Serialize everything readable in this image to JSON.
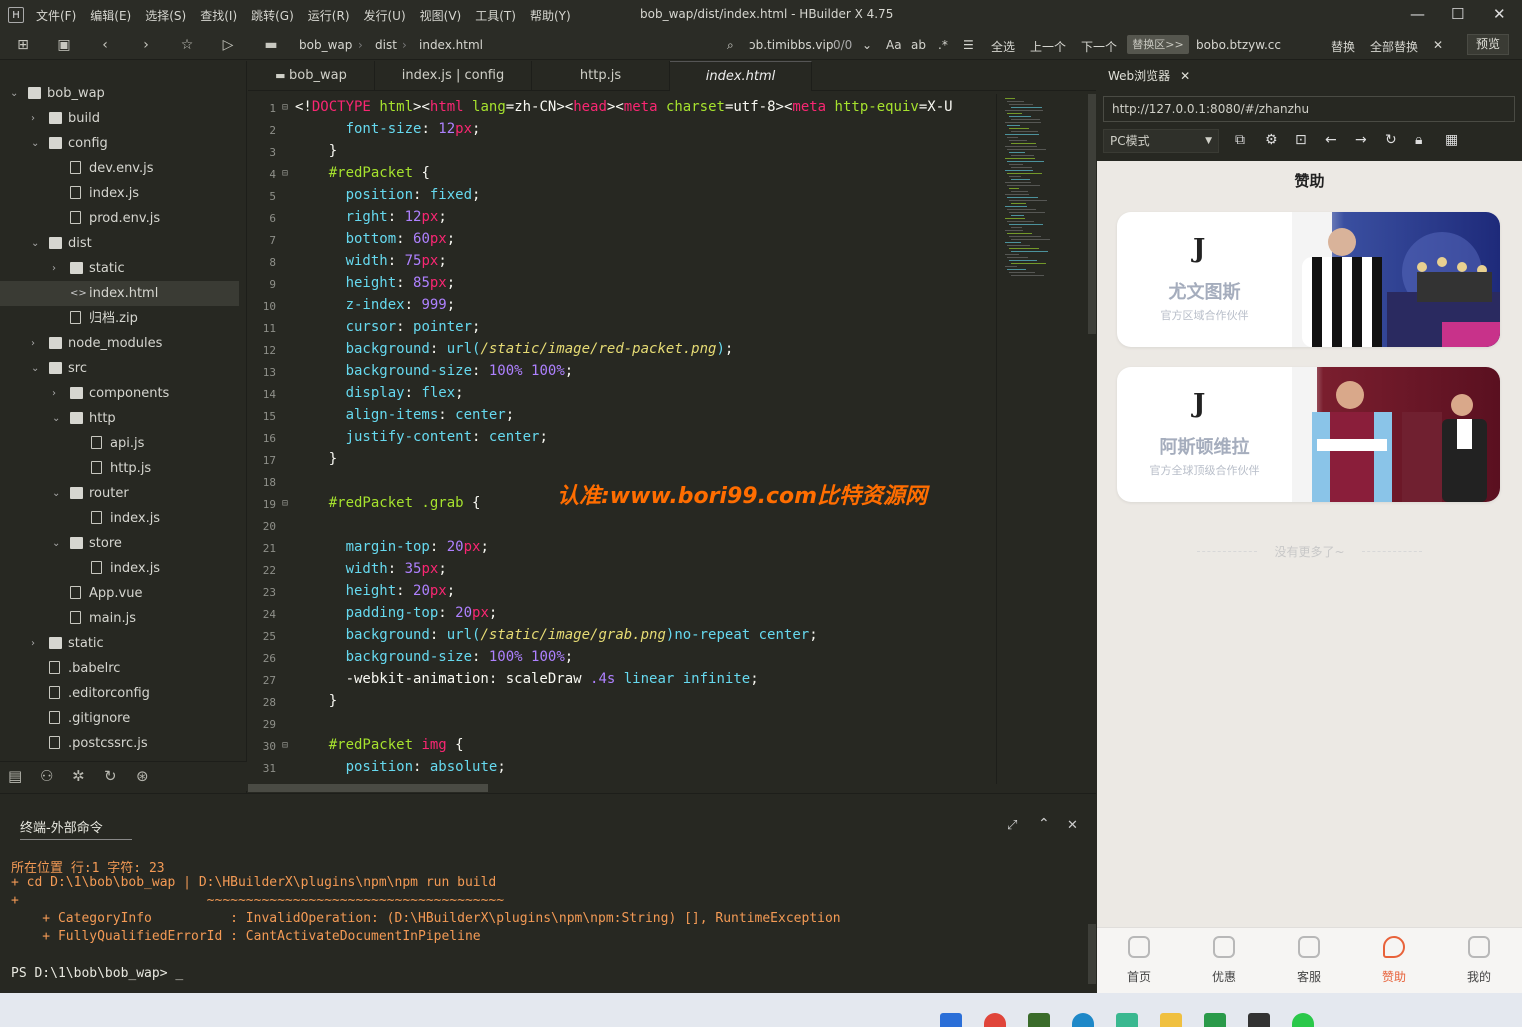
{
  "window": {
    "title": "bob_wap/dist/index.html - HBuilder X 4.75",
    "logo": "H",
    "menus": [
      "文件(F)",
      "编辑(E)",
      "选择(S)",
      "查找(I)",
      "跳转(G)",
      "运行(R)",
      "发行(U)",
      "视图(V)",
      "工具(T)",
      "帮助(Y)"
    ],
    "controls": {
      "minimize": "—",
      "maximize": "☐",
      "close": "✕"
    }
  },
  "toolbar": {
    "breadcrumb": [
      "bob_wap",
      "dist",
      "index.html"
    ],
    "search_value": "ɔb.timibbs.vip",
    "match_count": "0/0",
    "select_all": "全选",
    "prev": "上一个",
    "next": "下一个",
    "replace_area": "替换区>>",
    "replace_value": "bobo.btzyw.cc",
    "replace": "替换",
    "replace_all": "全部替换",
    "preview": "预览"
  },
  "tree": [
    {
      "label": "bob_wap",
      "type": "folder",
      "depth": 0,
      "open": true
    },
    {
      "label": "build",
      "type": "folder",
      "depth": 1,
      "open": false
    },
    {
      "label": "config",
      "type": "folder",
      "depth": 1,
      "open": true
    },
    {
      "label": "dev.env.js",
      "type": "file",
      "depth": 2
    },
    {
      "label": "index.js",
      "type": "file",
      "depth": 2
    },
    {
      "label": "prod.env.js",
      "type": "file",
      "depth": 2
    },
    {
      "label": "dist",
      "type": "folder",
      "depth": 1,
      "open": true
    },
    {
      "label": "static",
      "type": "folder",
      "depth": 2,
      "open": false
    },
    {
      "label": "index.html",
      "type": "html",
      "depth": 2,
      "selected": true
    },
    {
      "label": "归档.zip",
      "type": "file",
      "depth": 2
    },
    {
      "label": "node_modules",
      "type": "folder",
      "depth": 1,
      "open": false
    },
    {
      "label": "src",
      "type": "folder",
      "depth": 1,
      "open": true
    },
    {
      "label": "components",
      "type": "folder",
      "depth": 2,
      "open": false
    },
    {
      "label": "http",
      "type": "folder",
      "depth": 2,
      "open": true
    },
    {
      "label": "api.js",
      "type": "file",
      "depth": 3
    },
    {
      "label": "http.js",
      "type": "file",
      "depth": 3
    },
    {
      "label": "router",
      "type": "folder",
      "depth": 2,
      "open": true
    },
    {
      "label": "index.js",
      "type": "file",
      "depth": 3
    },
    {
      "label": "store",
      "type": "folder",
      "depth": 2,
      "open": true
    },
    {
      "label": "index.js",
      "type": "file",
      "depth": 3
    },
    {
      "label": "App.vue",
      "type": "file",
      "depth": 2
    },
    {
      "label": "main.js",
      "type": "file",
      "depth": 2
    },
    {
      "label": "static",
      "type": "folder",
      "depth": 1,
      "open": false
    },
    {
      "label": ".babelrc",
      "type": "file",
      "depth": 1
    },
    {
      "label": ".editorconfig",
      "type": "file",
      "depth": 1
    },
    {
      "label": ".gitignore",
      "type": "file",
      "depth": 1
    },
    {
      "label": ".postcssrc.js",
      "type": "file",
      "depth": 1
    }
  ],
  "tabs": [
    {
      "label": "bob_wap",
      "active": false
    },
    {
      "label": "index.js | config",
      "active": false
    },
    {
      "label": "http.js",
      "active": false
    },
    {
      "label": "index.html",
      "active": true
    }
  ],
  "code": [
    {
      "n": 1,
      "fold": true,
      "tokens": [
        [
          "pun",
          "<!"
        ],
        [
          "tag",
          "DOCTYPE"
        ],
        [
          "pun",
          " "
        ],
        [
          "attr",
          "html"
        ],
        [
          "pun",
          "><"
        ],
        [
          "tag",
          "html"
        ],
        [
          "pun",
          " "
        ],
        [
          "attr",
          "lang"
        ],
        [
          "pun",
          "=zh-CN><"
        ],
        [
          "tag",
          "head"
        ],
        [
          "pun",
          "><"
        ],
        [
          "tag",
          "meta"
        ],
        [
          "pun",
          " "
        ],
        [
          "attr",
          "charset"
        ],
        [
          "pun",
          "=utf-8><"
        ],
        [
          "tag",
          "meta"
        ],
        [
          "pun",
          " "
        ],
        [
          "attr",
          "http-equiv"
        ],
        [
          "pun",
          "=X-U"
        ]
      ]
    },
    {
      "n": 2,
      "tokens": [
        [
          "pun",
          "      "
        ],
        [
          "prop",
          "font-size"
        ],
        [
          "pun",
          ": "
        ],
        [
          "num",
          "12"
        ],
        [
          "unit",
          "px"
        ],
        [
          "pun",
          ";"
        ]
      ]
    },
    {
      "n": 3,
      "tokens": [
        [
          "pun",
          "    }"
        ]
      ]
    },
    {
      "n": 4,
      "fold": true,
      "tokens": [
        [
          "pun",
          "    "
        ],
        [
          "sel-k",
          "#redPacket"
        ],
        [
          "pun",
          " {"
        ]
      ]
    },
    {
      "n": 5,
      "tokens": [
        [
          "pun",
          "      "
        ],
        [
          "prop",
          "position"
        ],
        [
          "pun",
          ": "
        ],
        [
          "val",
          "fixed"
        ],
        [
          "pun",
          ";"
        ]
      ]
    },
    {
      "n": 6,
      "tokens": [
        [
          "pun",
          "      "
        ],
        [
          "prop",
          "right"
        ],
        [
          "pun",
          ": "
        ],
        [
          "num",
          "12"
        ],
        [
          "unit",
          "px"
        ],
        [
          "pun",
          ";"
        ]
      ]
    },
    {
      "n": 7,
      "tokens": [
        [
          "pun",
          "      "
        ],
        [
          "prop",
          "bottom"
        ],
        [
          "pun",
          ": "
        ],
        [
          "num",
          "60"
        ],
        [
          "unit",
          "px"
        ],
        [
          "pun",
          ";"
        ]
      ]
    },
    {
      "n": 8,
      "tokens": [
        [
          "pun",
          "      "
        ],
        [
          "prop",
          "width"
        ],
        [
          "pun",
          ": "
        ],
        [
          "num",
          "75"
        ],
        [
          "unit",
          "px"
        ],
        [
          "pun",
          ";"
        ]
      ]
    },
    {
      "n": 9,
      "tokens": [
        [
          "pun",
          "      "
        ],
        [
          "prop",
          "height"
        ],
        [
          "pun",
          ": "
        ],
        [
          "num",
          "85"
        ],
        [
          "unit",
          "px"
        ],
        [
          "pun",
          ";"
        ]
      ]
    },
    {
      "n": 10,
      "tokens": [
        [
          "pun",
          "      "
        ],
        [
          "prop",
          "z-index"
        ],
        [
          "pun",
          ": "
        ],
        [
          "num",
          "999"
        ],
        [
          "pun",
          ";"
        ]
      ]
    },
    {
      "n": 11,
      "tokens": [
        [
          "pun",
          "      "
        ],
        [
          "prop",
          "cursor"
        ],
        [
          "pun",
          ": "
        ],
        [
          "val",
          "pointer"
        ],
        [
          "pun",
          ";"
        ]
      ]
    },
    {
      "n": 12,
      "tokens": [
        [
          "pun",
          "      "
        ],
        [
          "prop",
          "background"
        ],
        [
          "pun",
          ": "
        ],
        [
          "val",
          "url("
        ],
        [
          "str",
          "/static/image/red-packet.png"
        ],
        [
          "val",
          ")"
        ],
        [
          "pun",
          ";"
        ]
      ]
    },
    {
      "n": 13,
      "tokens": [
        [
          "pun",
          "      "
        ],
        [
          "prop",
          "background-size"
        ],
        [
          "pun",
          ": "
        ],
        [
          "num",
          "100%"
        ],
        [
          "pun",
          " "
        ],
        [
          "num",
          "100%"
        ],
        [
          "pun",
          ";"
        ]
      ]
    },
    {
      "n": 14,
      "tokens": [
        [
          "pun",
          "      "
        ],
        [
          "prop",
          "display"
        ],
        [
          "pun",
          ": "
        ],
        [
          "val",
          "flex"
        ],
        [
          "pun",
          ";"
        ]
      ]
    },
    {
      "n": 15,
      "tokens": [
        [
          "pun",
          "      "
        ],
        [
          "prop",
          "align-items"
        ],
        [
          "pun",
          ": "
        ],
        [
          "val",
          "center"
        ],
        [
          "pun",
          ";"
        ]
      ]
    },
    {
      "n": 16,
      "tokens": [
        [
          "pun",
          "      "
        ],
        [
          "prop",
          "justify-content"
        ],
        [
          "pun",
          ": "
        ],
        [
          "val",
          "center"
        ],
        [
          "pun",
          ";"
        ]
      ]
    },
    {
      "n": 17,
      "tokens": [
        [
          "pun",
          "    }"
        ]
      ]
    },
    {
      "n": 18,
      "tokens": []
    },
    {
      "n": 19,
      "fold": true,
      "tokens": [
        [
          "pun",
          "    "
        ],
        [
          "sel-k",
          "#redPacket .grab"
        ],
        [
          "pun",
          " {"
        ]
      ]
    },
    {
      "n": 20,
      "tokens": []
    },
    {
      "n": 21,
      "tokens": [
        [
          "pun",
          "      "
        ],
        [
          "prop",
          "margin-top"
        ],
        [
          "pun",
          ": "
        ],
        [
          "num",
          "20"
        ],
        [
          "unit",
          "px"
        ],
        [
          "pun",
          ";"
        ]
      ]
    },
    {
      "n": 22,
      "tokens": [
        [
          "pun",
          "      "
        ],
        [
          "prop",
          "width"
        ],
        [
          "pun",
          ": "
        ],
        [
          "num",
          "35"
        ],
        [
          "unit",
          "px"
        ],
        [
          "pun",
          ";"
        ]
      ]
    },
    {
      "n": 23,
      "tokens": [
        [
          "pun",
          "      "
        ],
        [
          "prop",
          "height"
        ],
        [
          "pun",
          ": "
        ],
        [
          "num",
          "20"
        ],
        [
          "unit",
          "px"
        ],
        [
          "pun",
          ";"
        ]
      ]
    },
    {
      "n": 24,
      "tokens": [
        [
          "pun",
          "      "
        ],
        [
          "prop",
          "padding-top"
        ],
        [
          "pun",
          ": "
        ],
        [
          "num",
          "20"
        ],
        [
          "unit",
          "px"
        ],
        [
          "pun",
          ";"
        ]
      ]
    },
    {
      "n": 25,
      "tokens": [
        [
          "pun",
          "      "
        ],
        [
          "prop",
          "background"
        ],
        [
          "pun",
          ": "
        ],
        [
          "val",
          "url("
        ],
        [
          "str",
          "/static/image/grab.png"
        ],
        [
          "val",
          ")no-repeat center"
        ],
        [
          "pun",
          ";"
        ]
      ]
    },
    {
      "n": 26,
      "tokens": [
        [
          "pun",
          "      "
        ],
        [
          "prop",
          "background-size"
        ],
        [
          "pun",
          ": "
        ],
        [
          "num",
          "100%"
        ],
        [
          "pun",
          " "
        ],
        [
          "num",
          "100%"
        ],
        [
          "pun",
          ";"
        ]
      ]
    },
    {
      "n": 27,
      "tokens": [
        [
          "pun",
          "      -webkit-animation: scaleDraw "
        ],
        [
          "num",
          ".4s"
        ],
        [
          "pun",
          " "
        ],
        [
          "val",
          "linear infinite"
        ],
        [
          "pun",
          ";"
        ]
      ]
    },
    {
      "n": 28,
      "tokens": [
        [
          "pun",
          "    }"
        ]
      ]
    },
    {
      "n": 29,
      "tokens": []
    },
    {
      "n": 30,
      "fold": true,
      "tokens": [
        [
          "pun",
          "    "
        ],
        [
          "sel-k",
          "#redPacket "
        ],
        [
          "tag",
          "img"
        ],
        [
          "pun",
          " {"
        ]
      ]
    },
    {
      "n": 31,
      "tokens": [
        [
          "pun",
          "      "
        ],
        [
          "prop",
          "position"
        ],
        [
          "pun",
          ": "
        ],
        [
          "val",
          "absolute"
        ],
        [
          "pun",
          ";"
        ]
      ]
    }
  ],
  "watermark": "认准:www.bori99.com比特资源网",
  "terminal": {
    "tab": "终端-外部命令",
    "lines": [
      {
        "text": "所在位置 行:1 字符: 23",
        "cls": "term-orange"
      },
      {
        "text": "+ cd D:\\1\\bob\\bob_wap | D:\\HBuilderX\\plugins\\npm\\npm run build",
        "cls": "term-orange"
      },
      {
        "text": "+                        ~~~~~~~~~~~~~~~~~~~~~~~~~~~~~~~~~~~~~~",
        "cls": "term-orange"
      },
      {
        "text": "    + CategoryInfo          : InvalidOperation: (D:\\HBuilderX\\plugins\\npm\\npm:String) [], RuntimeException",
        "cls": "term-orange"
      },
      {
        "text": "    + FullyQualifiedErrorId : CantActivateDocumentInPipeline",
        "cls": "term-orange"
      },
      {
        "text": "",
        "cls": "term-orange"
      },
      {
        "text": "PS D:\\1\\bob\\bob_wap> _",
        "cls": "term-white"
      }
    ]
  },
  "browser": {
    "tab": "Web浏览器",
    "url": "http://127.0.0.1:8080/#/zhanzhu",
    "mode": "PC模式",
    "page_title": "赞助",
    "cards": [
      {
        "name": "尤文图斯",
        "sub": "官方区域合作伙伴"
      },
      {
        "name": "阿斯顿维拉",
        "sub": "官方全球顶级合作伙伴"
      }
    ],
    "no_more": "没有更多了~",
    "nav": [
      {
        "label": "首页",
        "active": false
      },
      {
        "label": "优惠",
        "active": false
      },
      {
        "label": "客服",
        "active": false
      },
      {
        "label": "赞助",
        "active": true
      },
      {
        "label": "我的",
        "active": false
      }
    ]
  },
  "colors": {
    "accent": "#e8623a",
    "editor_bg": "#272822",
    "watermark": "#ff6d00"
  }
}
